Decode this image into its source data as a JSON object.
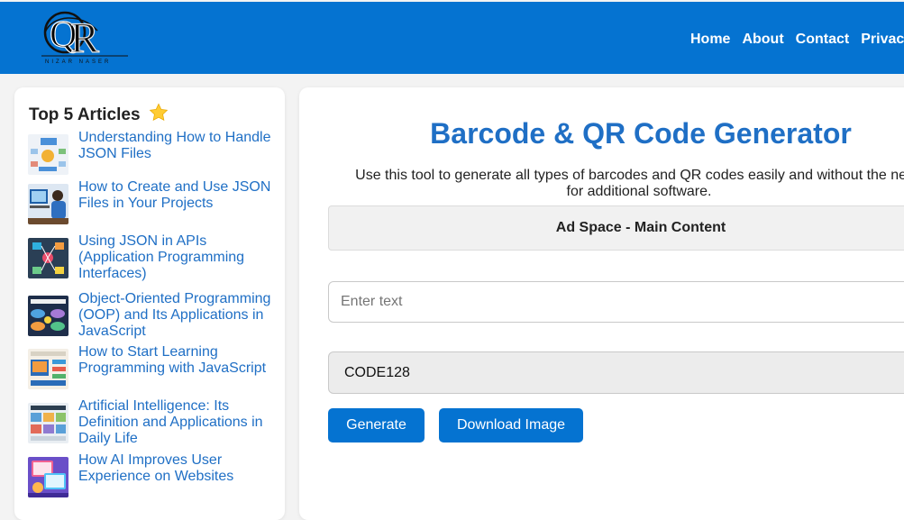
{
  "header": {
    "logo_letters": "QR",
    "logo_caption": "NIZAR NASER",
    "nav": [
      "Home",
      "About",
      "Contact",
      "Privacy"
    ]
  },
  "sidebar": {
    "title": "Top 5 Articles",
    "title_icon": "star-emoji",
    "articles": [
      {
        "title": "Understanding How to Handle JSON Files",
        "thumb": "json-infographic"
      },
      {
        "title": "How to Create and Use JSON Files in Your Projects",
        "thumb": "developer-at-desk"
      },
      {
        "title": "Using JSON in APIs (Application Programming Interfaces)",
        "thumb": "api-diagram-dark"
      },
      {
        "title": "Object-Oriented Programming (OOP) and Its Applications in JavaScript",
        "thumb": "oop-diagram"
      },
      {
        "title": "How to Start Learning Programming with JavaScript",
        "thumb": "javascript-infographic"
      },
      {
        "title": "Artificial Intelligence: Its Definition and Applications in Daily Life",
        "thumb": "ai-infographic"
      },
      {
        "title": "How AI Improves User Experience on Websites",
        "thumb": "ai-ux-illustration"
      }
    ]
  },
  "main": {
    "title": "Barcode & QR Code Generator",
    "description": "Use this tool to generate all types of barcodes and QR codes easily and without the need for additional software.",
    "ad_label": "Ad Space - Main Content",
    "input_placeholder": "Enter text",
    "input_value": "",
    "selected_format": "CODE128",
    "generate_label": "Generate",
    "download_label": "Download Image"
  },
  "colors": {
    "brand_blue": "#0573d1",
    "link_blue": "#1f6fc5",
    "page_bg": "#f3f3f3"
  }
}
